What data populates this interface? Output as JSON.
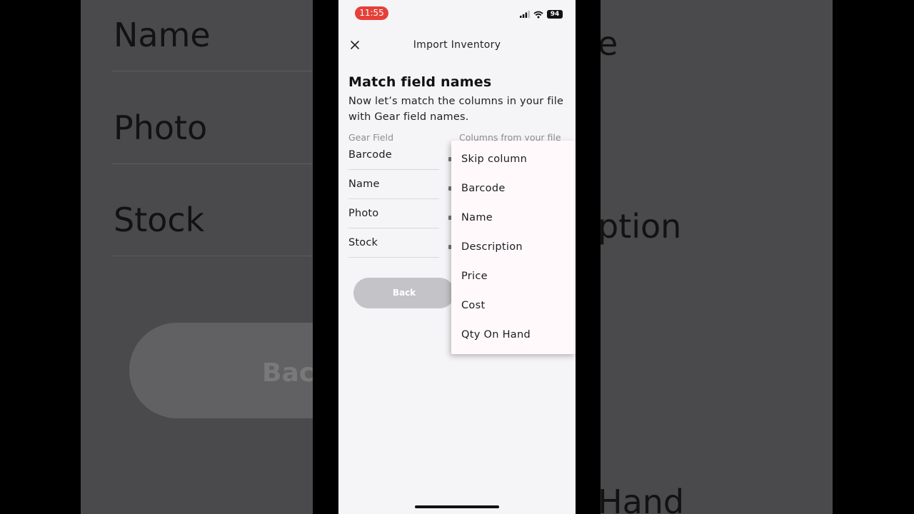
{
  "status_bar": {
    "time": "11:55",
    "battery": "94"
  },
  "header": {
    "title": "Import Inventory"
  },
  "main": {
    "heading": "Match field names",
    "subtitle": "Now let’s match the columns in your file with Gear field names.",
    "col_gear_field": "Gear Field",
    "col_file_columns": "Columns from your file",
    "fields": [
      "Barcode",
      "Name",
      "Photo",
      "Stock"
    ],
    "back_label": "Back"
  },
  "dropdown": {
    "options": [
      "Skip column",
      "Barcode",
      "Name",
      "Description",
      "Price",
      "Cost",
      "Qty On Hand"
    ]
  },
  "background": {
    "left_labels": [
      "Name",
      "Photo",
      "Stock"
    ],
    "right_labels": [
      "e",
      "ption",
      "Hand"
    ],
    "back_label": "Back"
  }
}
